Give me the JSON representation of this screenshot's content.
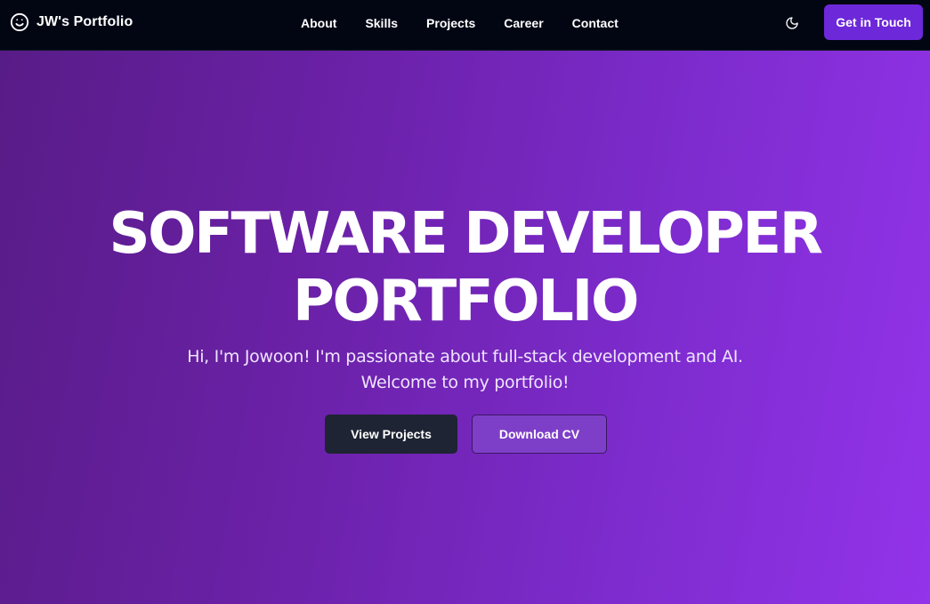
{
  "nav": {
    "brand_icon": "smiley-face-icon",
    "brand_label": "JW's Portfolio",
    "links": [
      "About",
      "Skills",
      "Projects",
      "Career",
      "Contact"
    ],
    "theme_toggle_icon": "moon-icon",
    "cta_label": "Get in Touch"
  },
  "hero": {
    "title_line1": "SOFTWARE DEVELOPER",
    "title_line2": "PORTFOLIO",
    "subtitle": "Hi, I'm Jowoon! I'm passionate about full-stack development and AI. Welcome to my portfolio!",
    "primary_button_label": "View Projects",
    "secondary_button_label": "Download CV"
  },
  "colors": {
    "nav_background": "#020613",
    "cta_background": "#6d28d9",
    "hero_gradient_start": "#581c87",
    "hero_gradient_end": "#9333ea",
    "primary_button_background": "#1e2433",
    "secondary_button_background": "#7e3fc8"
  }
}
